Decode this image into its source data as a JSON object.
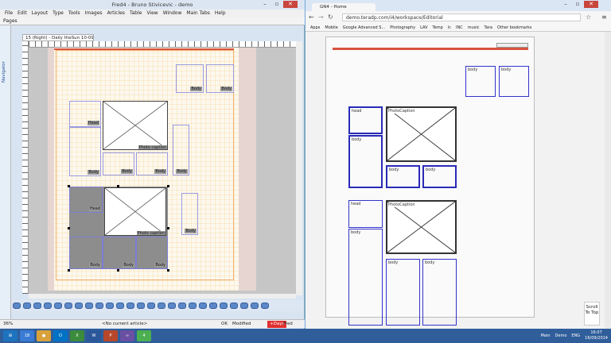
{
  "fred": {
    "title": "Fred4 - Bruno Stivicevic - demo",
    "menu": [
      "File",
      "Edit",
      "Layout",
      "Type",
      "Tools",
      "Images",
      "Articles",
      "Table",
      "View",
      "Window",
      "Main Tabs",
      "Help"
    ],
    "pages_label": "Pages",
    "navigator_label": "Navigator",
    "doc_tab": "15 (Right) - Daily theSun 10-09-2014",
    "box_label_body": "Body",
    "box_label_head": "Head",
    "photo_caption": "Photo caption",
    "status": {
      "zoom": "36%",
      "article": "<No current article>",
      "ok": "OK",
      "modified": "Modified",
      "days": "+Days",
      "user": "Fred"
    }
  },
  "chrome": {
    "tab_title": "GN4 - Home",
    "url": "demo.teradp.com/i4/workspace/Editorial",
    "bookmarks": [
      "Apps",
      "Mobile",
      "Google Advanced S...",
      "Photography",
      "LAV",
      "Temp",
      "lc",
      "INC",
      "music",
      "Tara",
      "Other bookmarks"
    ],
    "labels": {
      "body": "body",
      "head": "head",
      "photo_caption": "PhotoCaption"
    },
    "scroll_to_top": "Scroll To Top"
  },
  "taskbar": {
    "calendar_day": "18",
    "app_number": "4",
    "tray_user": "Main",
    "tray_demo": "Demo",
    "tray_lang": "ENG",
    "time": "16:07",
    "date": "16/09/2014"
  }
}
